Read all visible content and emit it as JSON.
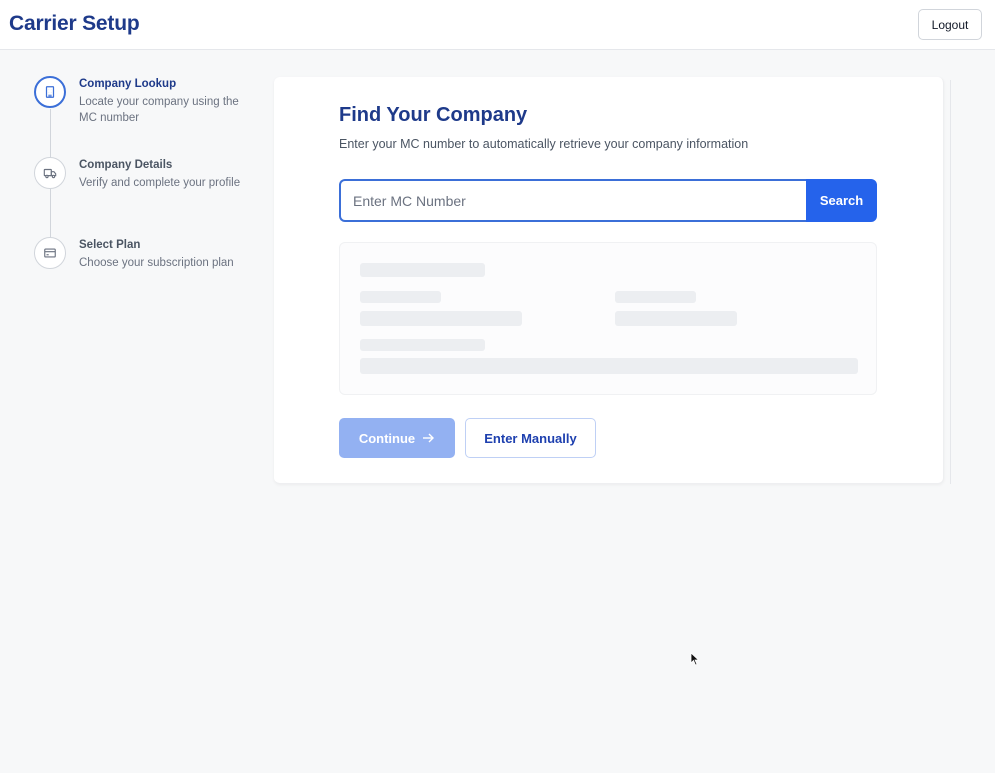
{
  "header": {
    "title": "Carrier Setup",
    "logout_label": "Logout"
  },
  "stepper": {
    "steps": [
      {
        "title": "Company Lookup",
        "description": "Locate your company using the MC number",
        "icon": "building-icon",
        "active": true
      },
      {
        "title": "Company Details",
        "description": "Verify and complete your profile",
        "icon": "truck-icon",
        "active": false
      },
      {
        "title": "Select Plan",
        "description": "Choose your subscription plan",
        "icon": "credit-card-icon",
        "active": false
      }
    ]
  },
  "main": {
    "title": "Find Your Company",
    "subtitle": "Enter your MC number to automatically retrieve your company information",
    "search": {
      "value": "",
      "placeholder": "Enter MC Number",
      "button_label": "Search"
    },
    "continue_label": "Continue",
    "manual_label": "Enter Manually"
  },
  "colors": {
    "brand_navy": "#1e3a8a",
    "primary_blue": "#2563eb",
    "disabled_blue": "#93b1f2"
  }
}
